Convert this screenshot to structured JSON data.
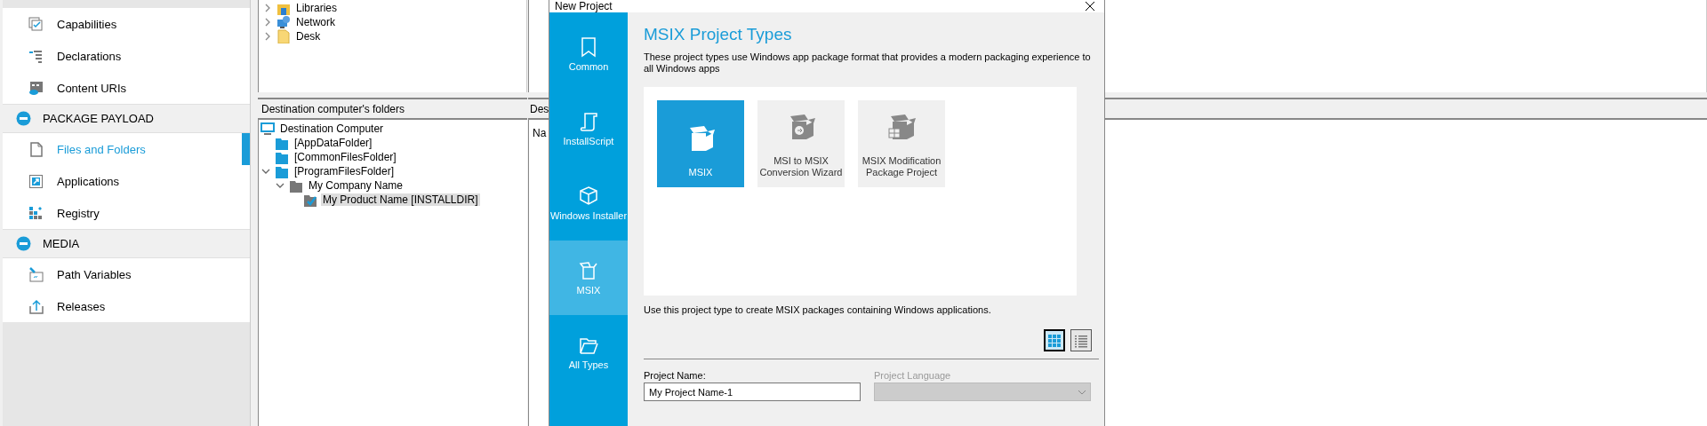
{
  "sidebar": {
    "sections": [
      {
        "items": [
          {
            "label": "Capabilities",
            "selected": false
          },
          {
            "label": "Declarations",
            "selected": false
          },
          {
            "label": "Content URIs",
            "selected": false
          }
        ]
      },
      {
        "title": "PACKAGE PAYLOAD",
        "expanded": true,
        "items": [
          {
            "label": "Files and Folders",
            "selected": true
          },
          {
            "label": "Applications",
            "selected": false
          },
          {
            "label": "Registry",
            "selected": false
          }
        ]
      },
      {
        "title": "MEDIA",
        "expanded": true,
        "items": [
          {
            "label": "Path Variables",
            "selected": false
          },
          {
            "label": "Releases",
            "selected": false
          }
        ]
      }
    ]
  },
  "source_tree": [
    {
      "label": "Libraries",
      "expanded": false
    },
    {
      "label": "Network",
      "expanded": false
    },
    {
      "label": "Desk",
      "expanded": false
    }
  ],
  "destination": {
    "header": "Destination computer's folders",
    "tree": [
      {
        "label": "Destination Computer",
        "selected": false,
        "children": [
          {
            "label": "[AppDataFolder]",
            "selected": false
          },
          {
            "label": "[CommonFilesFolder]",
            "selected": false
          },
          {
            "label": "[ProgramFilesFolder]",
            "selected": false,
            "expanded": true,
            "children": [
              {
                "label": "My Company Name",
                "selected": false,
                "expanded": true,
                "children": [
                  {
                    "label": "My Product Name [INSTALLDIR]",
                    "selected": true
                  }
                ]
              }
            ]
          }
        ]
      }
    ]
  },
  "files_pane": {
    "header": "Des",
    "column_1": "Na"
  },
  "dialog": {
    "title": "New Project",
    "nav": [
      {
        "label": "Common",
        "selected": false
      },
      {
        "label": "InstallScript",
        "selected": false
      },
      {
        "label": "Windows Installer",
        "selected": false
      },
      {
        "label": "MSIX",
        "selected": true
      },
      {
        "label": "All Types",
        "selected": false
      }
    ],
    "heading": "MSIX Project Types",
    "description": "These project types use Windows app package format that provides a modern packaging experience to all Windows apps",
    "project_types": [
      {
        "label": "MSIX",
        "selected": true
      },
      {
        "label": "MSI to MSIX Conversion Wizard",
        "selected": false
      },
      {
        "label": "MSIX Modification Package Project",
        "selected": false
      }
    ],
    "type_description": "Use this project type to create MSIX packages containing Windows applications.",
    "views": [
      {
        "kind": "grid",
        "selected": true
      },
      {
        "kind": "list",
        "selected": false
      }
    ],
    "project_name": {
      "label": "Project Name:",
      "value": "My Project Name-1"
    },
    "project_language": {
      "label": "Project Language",
      "disabled": true
    }
  }
}
